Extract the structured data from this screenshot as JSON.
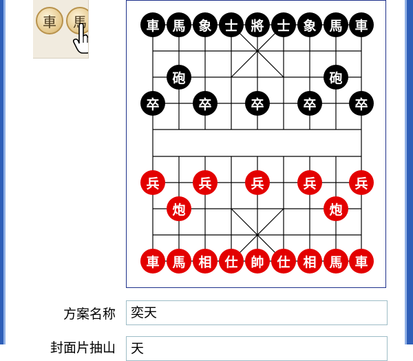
{
  "preview": {
    "pieces": [
      {
        "char": "車"
      },
      {
        "char": "馬"
      }
    ]
  },
  "board": {
    "black_back_row": [
      "車",
      "馬",
      "象",
      "士",
      "將",
      "士",
      "象",
      "馬",
      "車"
    ],
    "black_cannons": [
      {
        "char": "砲",
        "file": 1
      },
      {
        "char": "砲",
        "file": 7
      }
    ],
    "black_soldiers": [
      {
        "char": "卒",
        "file": 0
      },
      {
        "char": "卒",
        "file": 2
      },
      {
        "char": "卒",
        "file": 4
      },
      {
        "char": "卒",
        "file": 6
      },
      {
        "char": "卒",
        "file": 8
      }
    ],
    "red_soldiers": [
      {
        "char": "兵",
        "file": 0
      },
      {
        "char": "兵",
        "file": 2
      },
      {
        "char": "兵",
        "file": 4
      },
      {
        "char": "兵",
        "file": 6
      },
      {
        "char": "兵",
        "file": 8
      }
    ],
    "red_cannons": [
      {
        "char": "炮",
        "file": 1
      },
      {
        "char": "炮",
        "file": 7
      }
    ],
    "red_back_row": [
      "車",
      "馬",
      "相",
      "仕",
      "帥",
      "仕",
      "相",
      "馬",
      "車"
    ]
  },
  "form": {
    "scheme_name_label": "方案名称",
    "scheme_name_value": "奕天",
    "second_label": "封面片抽山",
    "second_value": "天"
  },
  "colors": {
    "red_piece": "#e30000",
    "black_piece": "#000000",
    "board_border": "#1c2f8a",
    "window_edge": "#2f5fb8"
  }
}
